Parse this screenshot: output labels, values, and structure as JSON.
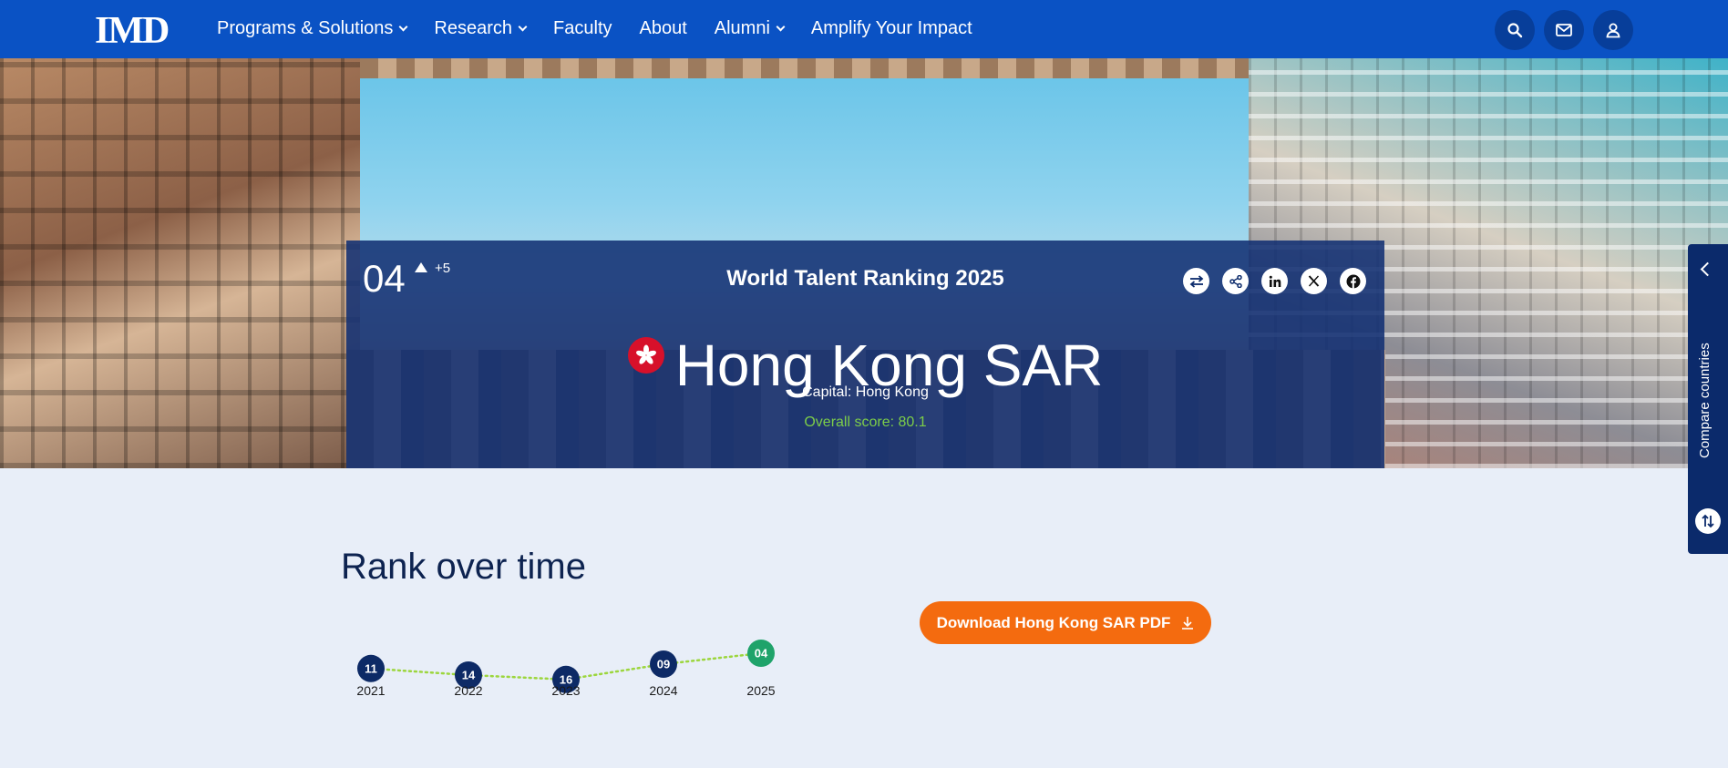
{
  "nav": {
    "logo": "IMD",
    "items": [
      {
        "label": "Programs & Solutions",
        "dropdown": true
      },
      {
        "label": "Research",
        "dropdown": true
      },
      {
        "label": "Faculty",
        "dropdown": false
      },
      {
        "label": "About",
        "dropdown": false
      },
      {
        "label": "Alumni",
        "dropdown": true
      },
      {
        "label": "Amplify Your Impact",
        "dropdown": false
      }
    ],
    "icons": [
      "search-icon",
      "mail-icon",
      "user-icon"
    ],
    "background": "#0a52c4"
  },
  "hero": {
    "rank": "04",
    "rank_change": "+5",
    "title": "World Talent Ranking 2025",
    "country": "Hong Kong SAR",
    "capital": "Capital: Hong Kong",
    "overall_score": "Overall score: 80.1",
    "social_icons": [
      "compare-icon",
      "share-icon",
      "linkedin-icon",
      "x-icon",
      "facebook-icon"
    ]
  },
  "compare": {
    "label": "Compare countries"
  },
  "rank_section": {
    "title": "Rank over time",
    "download_label": "Download Hong Kong SAR PDF"
  },
  "chart_data": {
    "type": "line",
    "x": [
      "2021",
      "2022",
      "2023",
      "2024",
      "2025"
    ],
    "series": [
      {
        "values": [
          11,
          14,
          16,
          9,
          4
        ],
        "labels": [
          "11",
          "14",
          "16",
          "09",
          "04"
        ]
      }
    ],
    "colors": {
      "point": "#0d2a66",
      "current": "#1fa36a",
      "line": "#9cd63d"
    }
  }
}
